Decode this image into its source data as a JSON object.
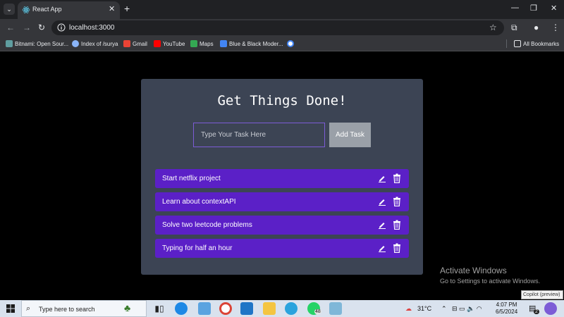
{
  "browser": {
    "tab_title": "React App",
    "tab_close": "✕",
    "new_tab": "+",
    "url": "localhost:3000",
    "window_controls": {
      "minimize": "—",
      "restore": "❐",
      "close": "✕"
    }
  },
  "bookmarks": {
    "items": [
      {
        "label": "Bitnami: Open Sour...",
        "color": "#5f9ea0"
      },
      {
        "label": "Index of /surya",
        "color": "#8ab4f8"
      },
      {
        "label": "Gmail",
        "color": "#ea4335"
      },
      {
        "label": "YouTube",
        "color": "#ff0000"
      },
      {
        "label": "Maps",
        "color": "#34a853"
      },
      {
        "label": "Blue & Black Moder...",
        "color": "#4285f4"
      }
    ],
    "all_bookmarks": "All Bookmarks"
  },
  "app": {
    "heading": "Get Things Done!",
    "input_placeholder": "Type Your Task Here",
    "add_button": "Add Task",
    "todos": [
      "Start netflix project",
      "Learn about contextAPI",
      "Solve two leetcode problems",
      "Typing for half an hour"
    ]
  },
  "overlay": {
    "activate_title": "Activate Windows",
    "activate_sub": "Go to Settings to activate Windows.",
    "copilot_tooltip": "Copilot (preview)"
  },
  "taskbar": {
    "search_placeholder": "Type here to search",
    "whatsapp_badge": "48",
    "weather": "31°C",
    "time": "4:07 PM",
    "date": "6/5/2024",
    "notification_count": "2"
  },
  "colors": {
    "card_bg": "#3c4454",
    "todo_bg": "#5b20c7",
    "input_border": "#7c5cd6",
    "button_bg": "#9aa0a8"
  }
}
